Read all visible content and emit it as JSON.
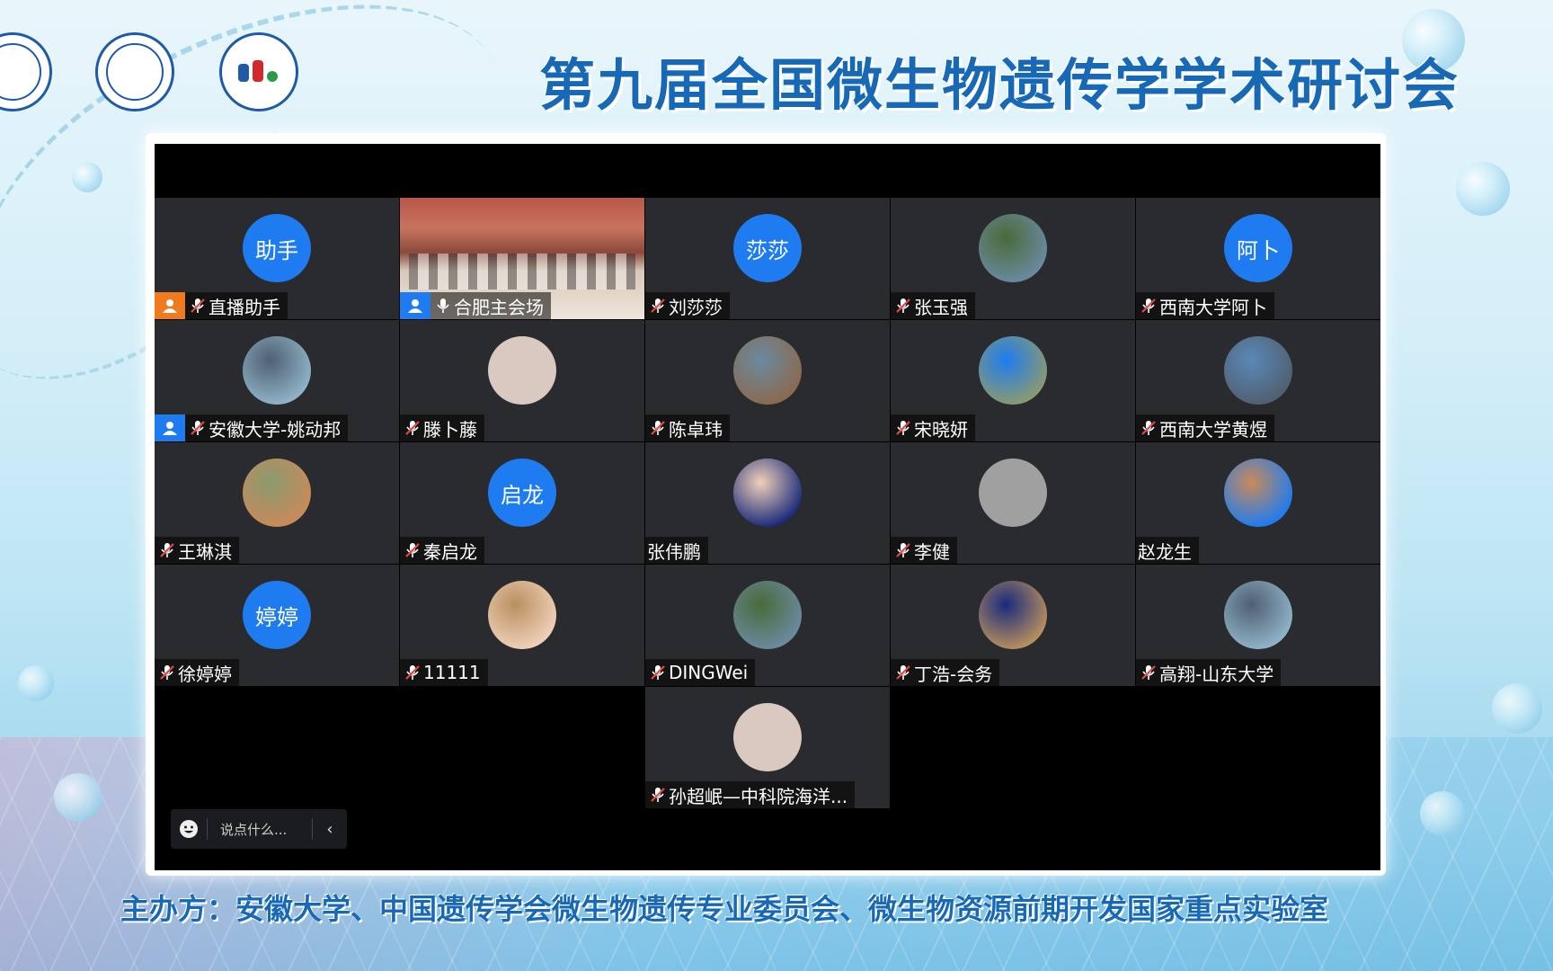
{
  "title": "第九届全国微生物遗传学学术研讨会",
  "footer": "主办方：安徽大学、中国遗传学会微生物遗传专业委员会、微生物资源前期开发国家重点实验室",
  "logos": [
    "ahu-logo",
    "genetics-society-logo",
    "organizer-logo"
  ],
  "participants": [
    {
      "name": "直播助手",
      "avatar_text": "助手",
      "badge": "orange",
      "mic": "muted"
    },
    {
      "name": "合肥主会场",
      "avatar_text": "",
      "badge": "blue",
      "mic": "on",
      "video": true,
      "active": true
    },
    {
      "name": "刘莎莎",
      "avatar_text": "莎莎",
      "mic": "muted"
    },
    {
      "name": "张玉强",
      "avatar_text": "",
      "mic": "muted"
    },
    {
      "name": "西南大学阿卜",
      "avatar_text": "阿卜",
      "mic": "muted"
    },
    {
      "name": "安徽大学-姚动邦",
      "avatar_text": "",
      "badge": "blue",
      "mic": "muted"
    },
    {
      "name": "滕卜藤",
      "avatar_text": "",
      "mic": "muted"
    },
    {
      "name": "陈卓玮",
      "avatar_text": "",
      "mic": "muted"
    },
    {
      "name": "宋晓妍",
      "avatar_text": "",
      "mic": "muted"
    },
    {
      "name": "西南大学黄煜",
      "avatar_text": "",
      "mic": "muted"
    },
    {
      "name": "王琳淇",
      "avatar_text": "",
      "mic": "muted"
    },
    {
      "name": "秦启龙",
      "avatar_text": "启龙",
      "mic": "muted"
    },
    {
      "name": "张伟鹏",
      "avatar_text": "",
      "mic": "none"
    },
    {
      "name": "李健",
      "avatar_text": "",
      "mic": "muted"
    },
    {
      "name": "赵龙生",
      "avatar_text": "",
      "mic": "none"
    },
    {
      "name": "徐婷婷",
      "avatar_text": "婷婷",
      "mic": "muted"
    },
    {
      "name": "11111",
      "avatar_text": "",
      "mic": "muted"
    },
    {
      "name": "DINGWei",
      "avatar_text": "",
      "mic": "muted"
    },
    {
      "name": "丁浩-会务",
      "avatar_text": "",
      "mic": "muted"
    },
    {
      "name": "高翔-山东大学",
      "avatar_text": "",
      "mic": "muted"
    },
    {
      "name": "孙超岷—中科院海洋...",
      "avatar_text": "",
      "mic": "muted"
    }
  ],
  "avatar_colors": [
    "#1e7cf0",
    "#8fb3c9",
    "#c98a5a",
    "#4a6a3a",
    "#d9c9c0",
    "#5a88b8",
    "#f0d0b8",
    "#8a6a50",
    "#1a2a7a",
    "#6a8aa0",
    "#8a9a70",
    "#a0a0a0",
    "#b89060",
    "#506070"
  ],
  "chat": {
    "placeholder": "说点什么...",
    "emoji_icon": "smiley-icon",
    "collapse_icon": "chevron-left-icon"
  },
  "colors": {
    "title": "#1769b5",
    "tile_bg": "#2a2b2e",
    "avatar_blue": "#1e7cf0",
    "active_border": "#3ecf62",
    "badge_orange": "#f07a1e"
  }
}
